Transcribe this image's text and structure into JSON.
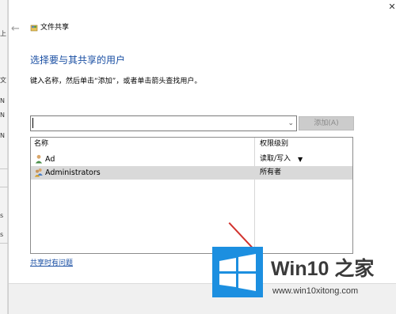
{
  "background_window": {
    "fragments": [
      "上",
      "文",
      "N",
      "N",
      "N",
      "s",
      "s"
    ]
  },
  "dialog": {
    "title": "文件共享",
    "close_glyph": "✕",
    "back_glyph": "←",
    "heading": "选择要与其共享的用户",
    "instruction": "键入名称，然后单击“添加”，或者单击箭头查找用户。",
    "name_input": {
      "value": ""
    },
    "add_button_label": "添加(A)",
    "table": {
      "headers": [
        "名称",
        "权限级别"
      ],
      "rows": [
        {
          "name": "Ad",
          "permission": "读取/写入",
          "has_dropdown": true,
          "selected": false
        },
        {
          "name": "Administrators",
          "permission": "所有者",
          "has_dropdown": false,
          "selected": true
        }
      ]
    },
    "help_link": "共享时有问题"
  },
  "watermark": {
    "brand": "Win10 之家",
    "url": "www.win10xitong.com"
  },
  "colors": {
    "heading_blue": "#1a4fa3",
    "watermark_blue": "#1c8fe0",
    "annotation_red": "#d2322d",
    "selected_row": "#d9d9d9"
  }
}
